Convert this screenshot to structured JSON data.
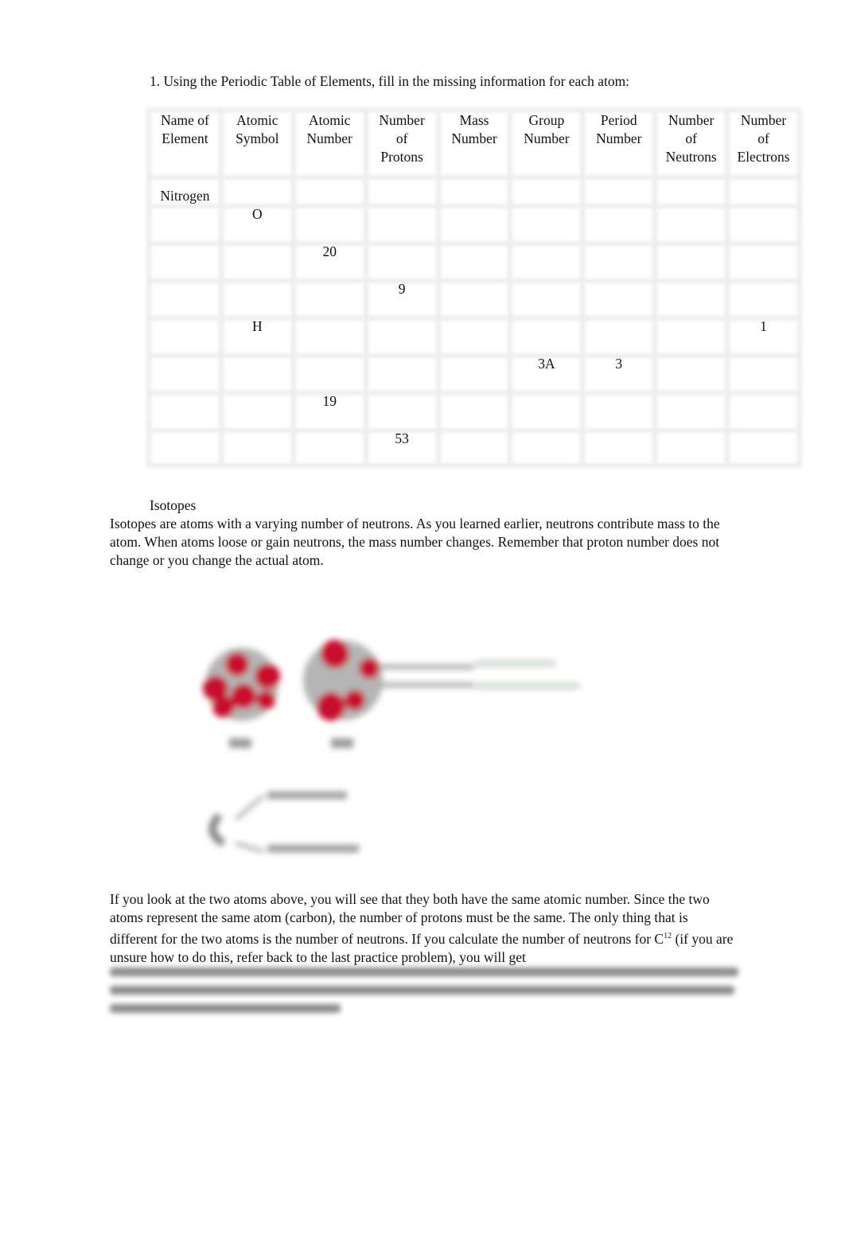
{
  "question": "1. Using the Periodic Table of Elements, fill in the missing information for each atom:",
  "table": {
    "headers": [
      [
        "Name of",
        "Element"
      ],
      [
        "Atomic",
        "Symbol"
      ],
      [
        "Atomic",
        "Number"
      ],
      [
        "Number",
        "of",
        "Protons"
      ],
      [
        "Mass",
        "Number"
      ],
      [
        "Group",
        "Number"
      ],
      [
        "Period",
        "Number"
      ],
      [
        "Number",
        "of",
        "Neutrons"
      ],
      [
        "Number",
        "of",
        "Electrons"
      ]
    ],
    "rows": [
      [
        "Nitrogen",
        "",
        "",
        "",
        "",
        "",
        "",
        "",
        ""
      ],
      [
        "",
        "O",
        "",
        "",
        "",
        "",
        "",
        "",
        ""
      ],
      [
        "",
        "",
        "20",
        "",
        "",
        "",
        "",
        "",
        ""
      ],
      [
        "",
        "",
        "",
        "9",
        "",
        "",
        "",
        "",
        ""
      ],
      [
        "",
        "H",
        "",
        "",
        "",
        "",
        "",
        "",
        "1"
      ],
      [
        "",
        "",
        "",
        "",
        "",
        "3A",
        "3",
        "",
        ""
      ],
      [
        "",
        "",
        "19",
        "",
        "",
        "",
        "",
        "",
        ""
      ],
      [
        "",
        "",
        "",
        "53",
        "",
        "",
        "",
        "",
        ""
      ]
    ]
  },
  "isotopes": {
    "title": "Isotopes",
    "paragraph": "Isotopes are atoms with a varying number of neutrons. As you learned earlier, neutrons contribute mass to the atom. When atoms loose or gain neutrons, the mass number changes. Remember that proton number does not change or you change the actual atom.",
    "paragraph2_before": "If you look at the two atoms above, you will see that they both have the same atomic number. Since the two atoms represent the same atom (carbon), the number of protons must be the same. The only thing that is different for the two atoms is the number of neutrons. If you calculate the number of neutrons for C",
    "paragraph2_sup": "12",
    "paragraph2_after": " (if you are unsure how to do this, refer back to the last practice problem), you will get"
  },
  "colors": {
    "proton_red": "#c8102e",
    "neutron_gray": "#a8a8a8"
  }
}
